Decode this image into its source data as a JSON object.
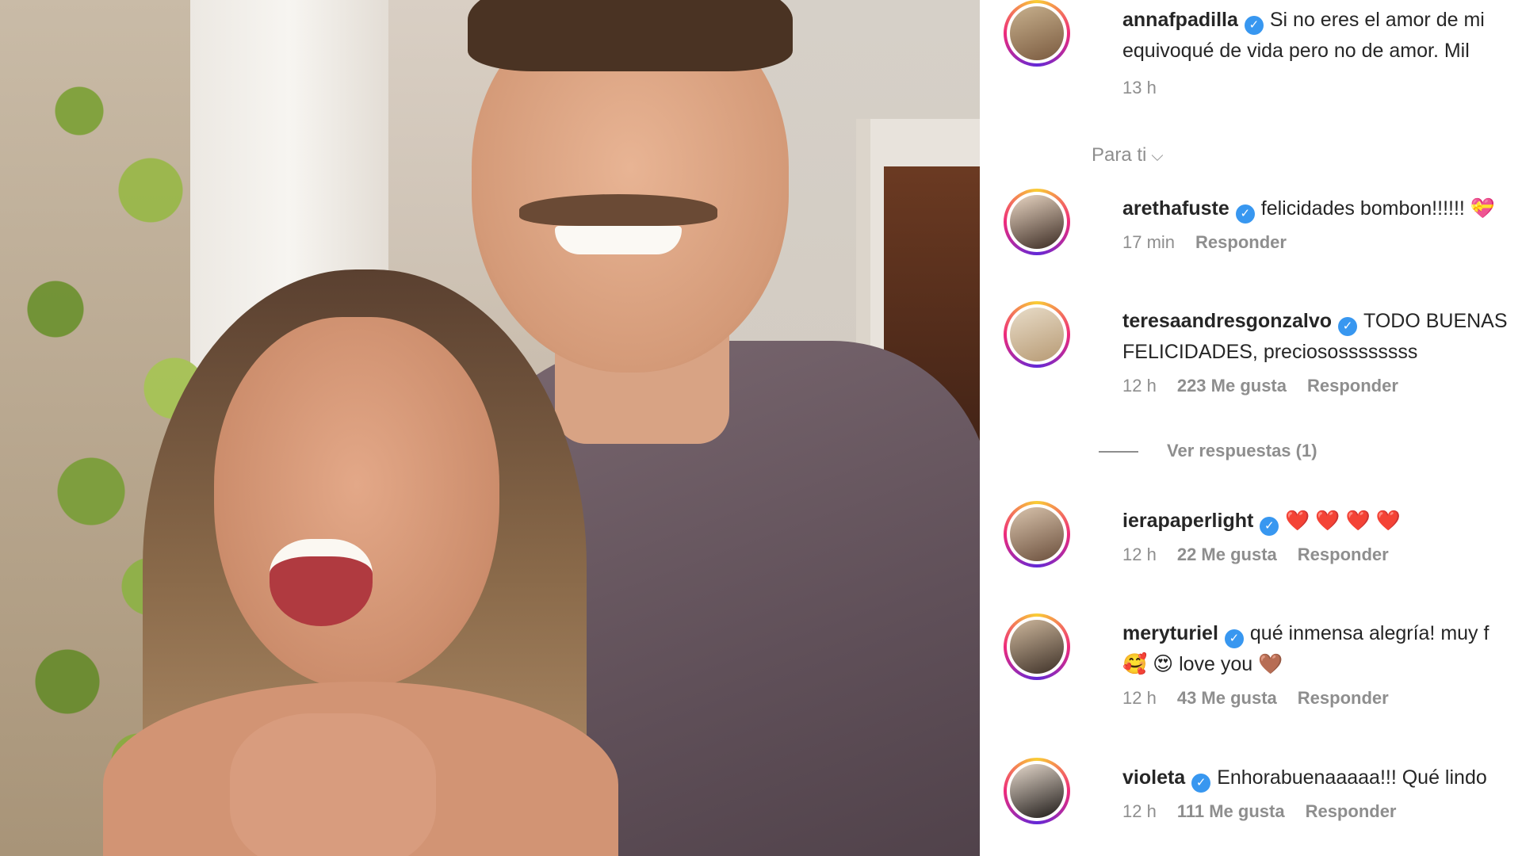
{
  "comments_panel": {
    "top_comment": {
      "username": "annafpadilla",
      "line1": "Si no eres el amor de mi",
      "line2": "equivoqué de vida pero no de amor. Mil",
      "time": "13 h"
    },
    "sort_label": "Para ti",
    "comments": [
      {
        "username": "arethafuste",
        "text": "felicidades bombon!!!!!! 💝",
        "text2": "",
        "time": "17 min",
        "likes": "",
        "reply": "Responder"
      },
      {
        "username": "teresaandresgonzalvo",
        "text": "TODO BUENAS",
        "text2": "FELICIDADES, preciosossssssss",
        "time": "12 h",
        "likes": "223 Me gusta",
        "reply": "Responder"
      },
      {
        "username": "ierapaperlight",
        "text": "❤️ ❤️ ❤️ ❤️",
        "text2": "",
        "time": "12 h",
        "likes": "22 Me gusta",
        "reply": "Responder"
      },
      {
        "username": "meryturiel",
        "text": "qué inmensa alegría! muy f",
        "text2": "🥰 😍 love you 🤎",
        "time": "12 h",
        "likes": "43 Me gusta",
        "reply": "Responder"
      },
      {
        "username": "violeta",
        "text": "Enhorabuenaaaaa!!! Qué lindo",
        "text2": "",
        "time": "12 h",
        "likes": "111 Me gusta",
        "reply": "Responder"
      }
    ],
    "view_replies": "Ver respuestas (1)"
  },
  "colors": {
    "verified_blue": "#3897f0",
    "meta_gray": "#8e8e8e",
    "text_dark": "#262626"
  }
}
